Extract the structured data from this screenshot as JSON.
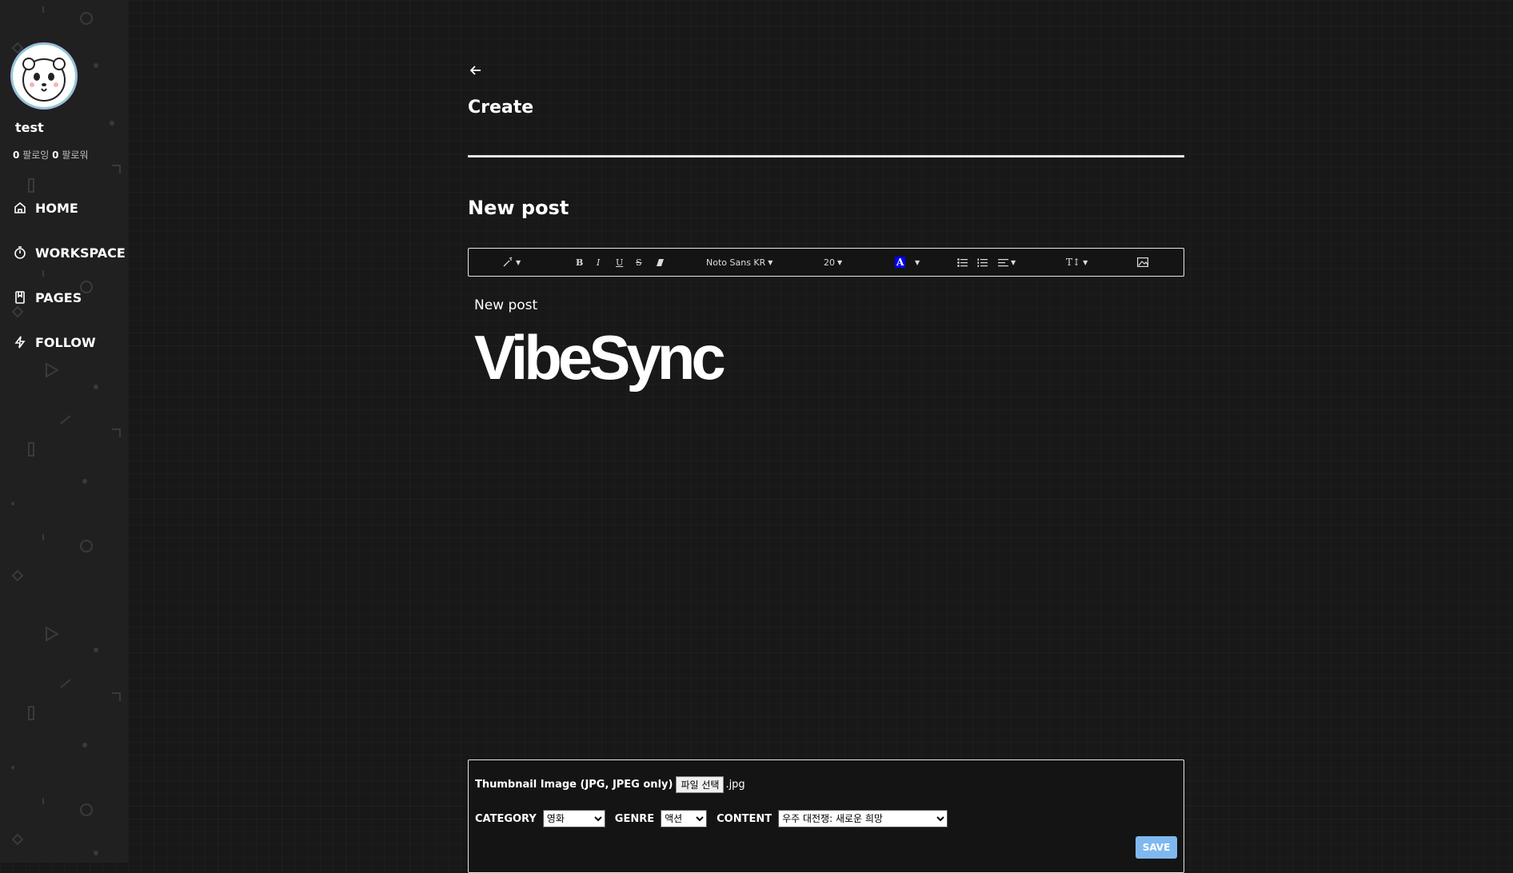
{
  "sidebar": {
    "username": "test",
    "following_count": "0",
    "following_label": "팔로잉",
    "followers_count": "0",
    "followers_label": "팔로워",
    "nav": [
      {
        "label": "HOME",
        "icon": "home-icon"
      },
      {
        "label": "WORKSPACE",
        "icon": "timer-icon"
      },
      {
        "label": "PAGES",
        "icon": "book-icon"
      },
      {
        "label": "FOLLOW",
        "icon": "bolt-icon"
      }
    ]
  },
  "page": {
    "heading": "Create",
    "title_value": "New post"
  },
  "toolbar": {
    "font_family": "Noto Sans KR",
    "font_size": "20",
    "color_letter": "A",
    "height_label": "T↕",
    "accent_color": "#0000ff"
  },
  "editor": {
    "text": "New post",
    "logo_text": "VibeSync"
  },
  "form": {
    "thumbnail_label": "Thumbnail Image (JPG, JPEG only)",
    "file_button": "파일 선택",
    "file_name": ".jpg",
    "category_label": "CATEGORY",
    "category_value": "영화",
    "genre_label": "GENRE",
    "genre_value": "액션",
    "content_label": "CONTENT",
    "content_value": "우주 대전쟁: 새로운 희망",
    "save_label": "SAVE",
    "save_color": "#7fb8f0"
  }
}
